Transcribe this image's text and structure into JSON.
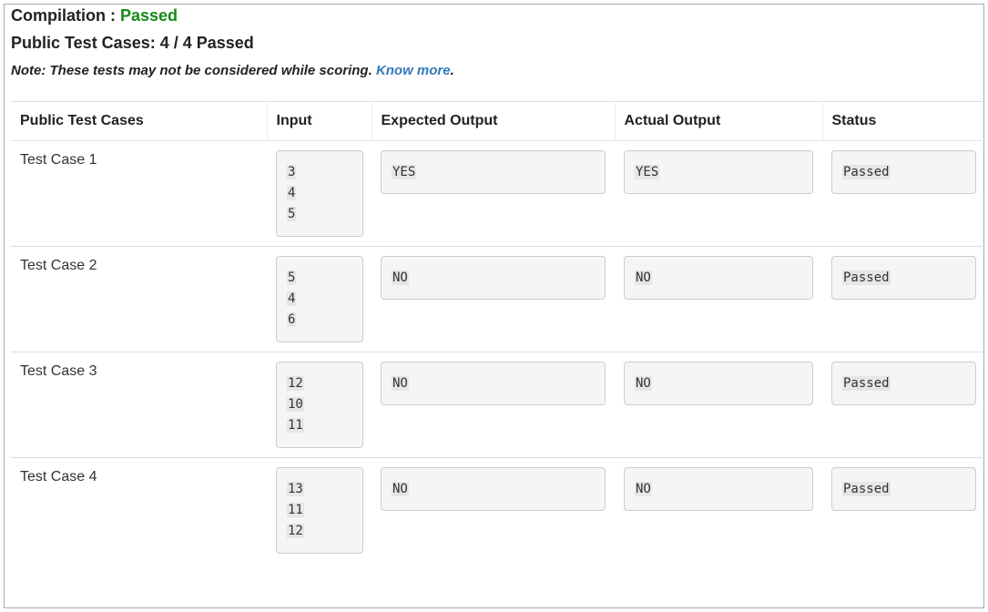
{
  "header": {
    "compilation_label": "Compilation : ",
    "compilation_status": "Passed",
    "summary": "Public Test Cases: 4 / 4 Passed",
    "note_text": "Note: These tests may not be considered while scoring. ",
    "note_link": "Know more",
    "note_end": "."
  },
  "table": {
    "columns": [
      "Public Test Cases",
      "Input",
      "Expected Output",
      "Actual Output",
      "Status"
    ],
    "rows": [
      {
        "name": "Test Case 1",
        "input": [
          "3",
          "4",
          "5"
        ],
        "expected": "YES",
        "actual": "YES",
        "status": "Passed"
      },
      {
        "name": "Test Case 2",
        "input": [
          "5",
          "4",
          "6"
        ],
        "expected": "NO",
        "actual": "NO",
        "status": "Passed"
      },
      {
        "name": "Test Case 3",
        "input": [
          "12",
          "10",
          "11"
        ],
        "expected": "NO",
        "actual": "NO",
        "status": "Passed"
      },
      {
        "name": "Test Case 4",
        "input": [
          "13",
          "11",
          "12"
        ],
        "expected": "NO",
        "actual": "NO",
        "status": "Passed"
      }
    ]
  },
  "colors": {
    "passed": "#178a17",
    "link": "#337ab7",
    "border": "#a9a9a9"
  }
}
